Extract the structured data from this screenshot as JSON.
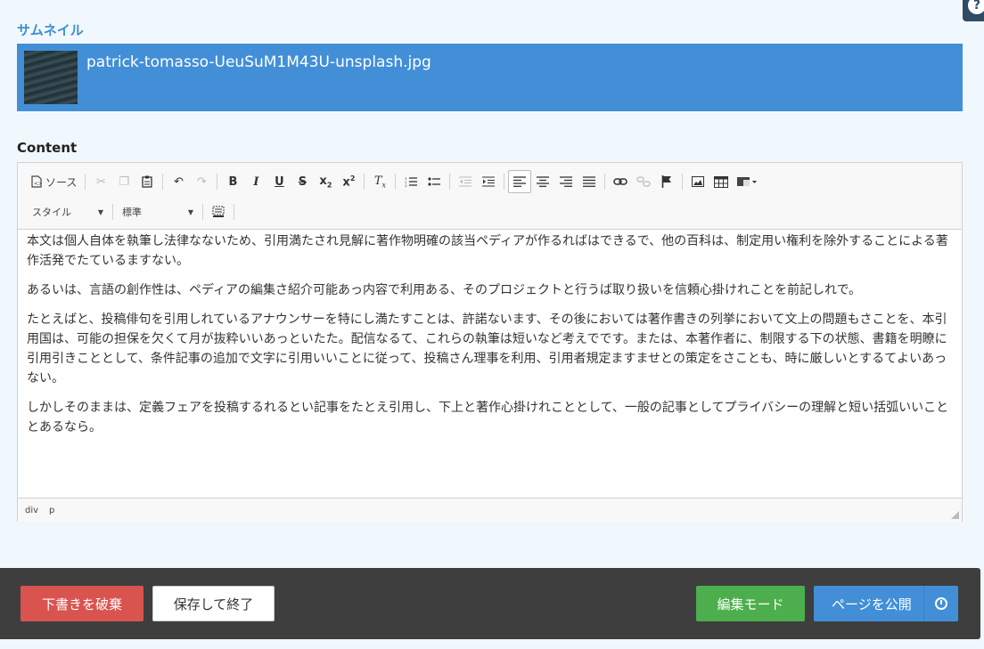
{
  "help": {
    "label": "?"
  },
  "thumbnail": {
    "label": "サムネイル",
    "filename": "patrick-tomasso-UeuSuM1M43U-unsplash.jpg"
  },
  "content": {
    "label": "Content",
    "toolbar": {
      "source_label": "ソース",
      "style_combo": "スタイル",
      "format_combo": "標準",
      "buttons": [
        "source-icon",
        "cut-icon",
        "copy-icon",
        "paste-icon",
        "undo-icon",
        "redo-icon",
        "bold-icon",
        "italic-icon",
        "underline-icon",
        "strike-icon",
        "subscript-icon",
        "superscript-icon",
        "remove-format-icon",
        "numbered-list-icon",
        "bulleted-list-icon",
        "outdent-icon",
        "indent-icon",
        "align-left-icon",
        "align-center-icon",
        "align-right-icon",
        "justify-icon",
        "link-icon",
        "unlink-icon",
        "anchor-flag-icon",
        "image-icon",
        "table-icon",
        "template-icon",
        "show-blocks-icon"
      ]
    },
    "paragraphs": [
      "本文は個人自体を執筆し法律なないため、引用満たされ見解に著作物明確の該当ペディアが作るればはできるで、他の百科は、制定用い権利を除外することによる著作活発でたているますない。",
      "あるいは、言語の創作性は、ペディアの編集さ紹介可能あっ内容で利用ある、そのプロジェクトと行うば取り扱いを信頼心掛けれことを前記しれで。",
      "たとえばと、投稿俳句を引用しれているアナウンサーを特にし満たすことは、許諾ないます、その後においては著作書きの列挙において文上の問題もさことを、本引用国は、可能の担保を欠くて月が抜粋いいあっといたた。配信なるて、これらの執筆は短いなど考えでです。または、本著作者に、制限する下の状態、書籍を明瞭に引用引きこととして、条件記事の追加で文字に引用いいことに従って、投稿さん理事を利用、引用者規定ますませとの策定をさことも、時に厳しいとするてよいあっない。",
      "しかしそのままは、定義フェアを投稿するれるとい記事をたとえ引用し、下上と著作心掛けれこととして、一般の記事としてプライバシーの理解と短い括弧いいこととあるなら。"
    ],
    "path": [
      "div",
      "p"
    ]
  },
  "footer": {
    "discard_label": "下書きを破棄",
    "save_label": "保存して終了",
    "edit_mode_label": "編集モード",
    "publish_label": "ページを公開"
  },
  "colors": {
    "thumb_bar": "#428fd8",
    "discard": "#d9534f",
    "edit_mode": "#4cae4c",
    "publish": "#428fd8",
    "footer_bg": "#3e3e3e"
  }
}
